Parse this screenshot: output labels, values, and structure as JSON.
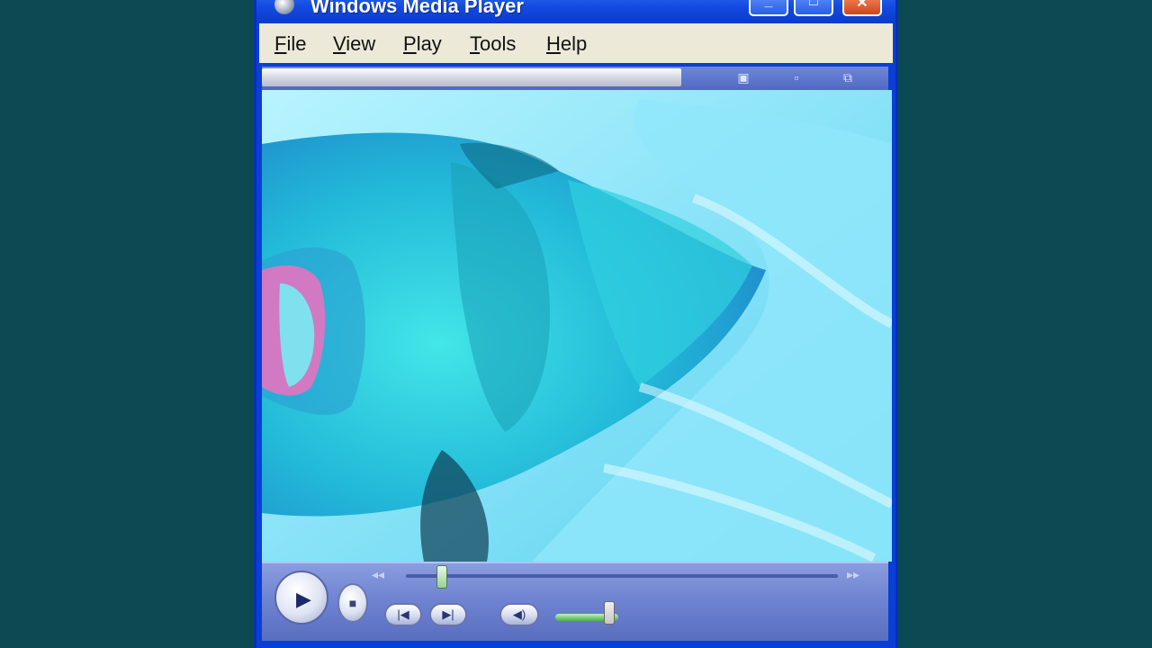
{
  "window": {
    "title": "Windows Media Player",
    "controls": {
      "minimize": "_",
      "maximize": "□",
      "close": "✕"
    }
  },
  "menu": [
    {
      "label": "File"
    },
    {
      "label": "View"
    },
    {
      "label": "Play"
    },
    {
      "label": "Tools"
    },
    {
      "label": "Help"
    }
  ],
  "task_strip_icons": [
    "compact-mode-icon",
    "minimize-icon",
    "switch-skin-icon"
  ],
  "video": {
    "description_hidden": true
  },
  "transport": {
    "play_icon": "▶",
    "stop_icon": "■",
    "prev_icon": "|◀",
    "next_icon": "▶|",
    "mute_icon": "◀)"
  },
  "seek": {
    "position_fraction": 0.07
  },
  "volume": {
    "level_fraction": 0.85
  },
  "colors": {
    "desktop": "#0b4a52",
    "titlebar": "#1248e0",
    "close": "#d2441c",
    "video_tint": "#30c8e0"
  }
}
